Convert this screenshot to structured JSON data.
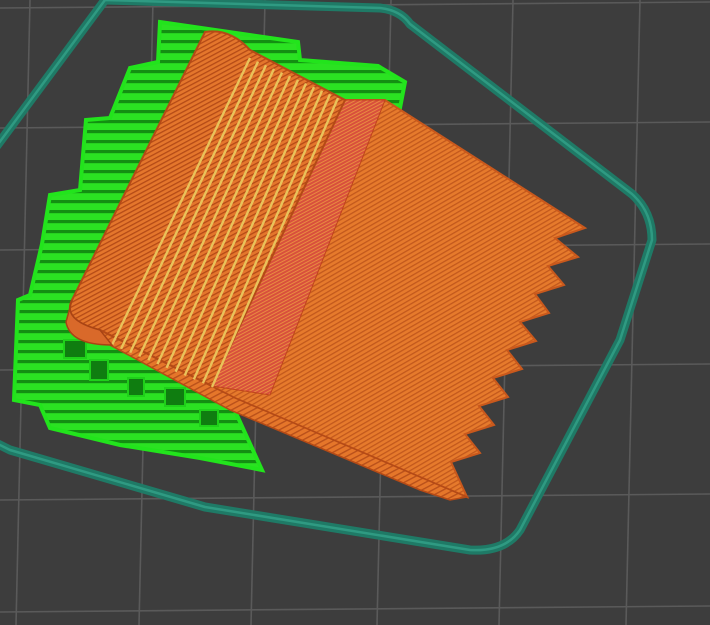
{
  "viewer": {
    "kind": "3D print slicer G-code preview",
    "background_color": "#3d3d3d",
    "grid_line_color": "#5a5a5a",
    "brim_skirt_color": "#1f7a66",
    "support_color": "#22e41c",
    "support_dark_color": "#0e8a0e",
    "model_wall_color": "#e5762a",
    "model_shade_color": "#c8561a",
    "top_solid_infill_color": "#e9c25a",
    "bridge_infill_color": "#d94a3a",
    "skirt_loops": 2,
    "teeth_count": 9
  }
}
